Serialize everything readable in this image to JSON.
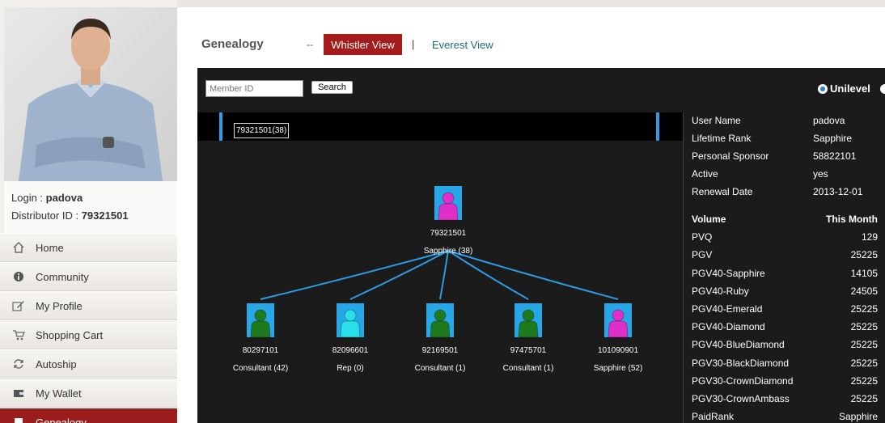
{
  "profile": {
    "login_label": "Login :",
    "login_value": "padova",
    "distributor_label": "Distributor ID :",
    "distributor_value": "79321501"
  },
  "menu": [
    {
      "label": "Home",
      "icon": "home-icon"
    },
    {
      "label": "Community",
      "icon": "info-icon"
    },
    {
      "label": "My Profile",
      "icon": "edit-icon"
    },
    {
      "label": "Shopping Cart",
      "icon": "cart-icon"
    },
    {
      "label": "Autoship",
      "icon": "refresh-icon"
    },
    {
      "label": "My Wallet",
      "icon": "wallet-icon"
    },
    {
      "label": "Genealogy",
      "icon": "genealogy-icon"
    }
  ],
  "header": {
    "title": "Genealogy",
    "dash": "--",
    "whistler": "Whistler View",
    "pipe": "|",
    "everest": "Everest View"
  },
  "controls": {
    "member_placeholder": "Member ID",
    "search_label": "Search",
    "radio_unilevel": "Unilevel"
  },
  "crumb": "79321501(38)",
  "root": {
    "id": "79321501",
    "rank": "Sapphire (38)",
    "color": "#e02fc9"
  },
  "children": [
    {
      "id": "80297101",
      "rank": "Consultant (42)",
      "color": "#1f7a1f"
    },
    {
      "id": "82096601",
      "rank": "Rep (0)",
      "color": "#27e0e8"
    },
    {
      "id": "92169501",
      "rank": "Consultant (1)",
      "color": "#1f7a1f"
    },
    {
      "id": "97475701",
      "rank": "Consultant (1)",
      "color": "#1f7a1f"
    },
    {
      "id": "101090901",
      "rank": "Sapphire (52)",
      "color": "#e02fc9"
    }
  ],
  "info": [
    {
      "label": "User Name",
      "value": "padova"
    },
    {
      "label": "Lifetime Rank",
      "value": "Sapphire"
    },
    {
      "label": "Personal Sponsor",
      "value": "58822101"
    },
    {
      "label": "Active",
      "value": "yes"
    },
    {
      "label": "Renewal Date",
      "value": "2013-12-01"
    }
  ],
  "volume": {
    "label": "Volume",
    "period": "This Month",
    "rows": [
      {
        "label": "PVQ",
        "value": "129"
      },
      {
        "label": "PGV",
        "value": "25225"
      },
      {
        "label": "PGV40-Sapphire",
        "value": "14105"
      },
      {
        "label": "PGV40-Ruby",
        "value": "24505"
      },
      {
        "label": "PGV40-Emerald",
        "value": "25225"
      },
      {
        "label": "PGV40-Diamond",
        "value": "25225"
      },
      {
        "label": "PGV40-BlueDiamond",
        "value": "25225"
      },
      {
        "label": "PGV30-BlackDiamond",
        "value": "25225"
      },
      {
        "label": "PGV30-CrownDiamond",
        "value": "25225"
      },
      {
        "label": "PGV30-CrownAmbass",
        "value": "25225"
      },
      {
        "label": "PaidRank",
        "value": "Sapphire"
      }
    ]
  },
  "colors": {
    "accent": "#a41b1b",
    "tree_line": "#2e9be6",
    "icon_bg": "#27a7e8"
  }
}
